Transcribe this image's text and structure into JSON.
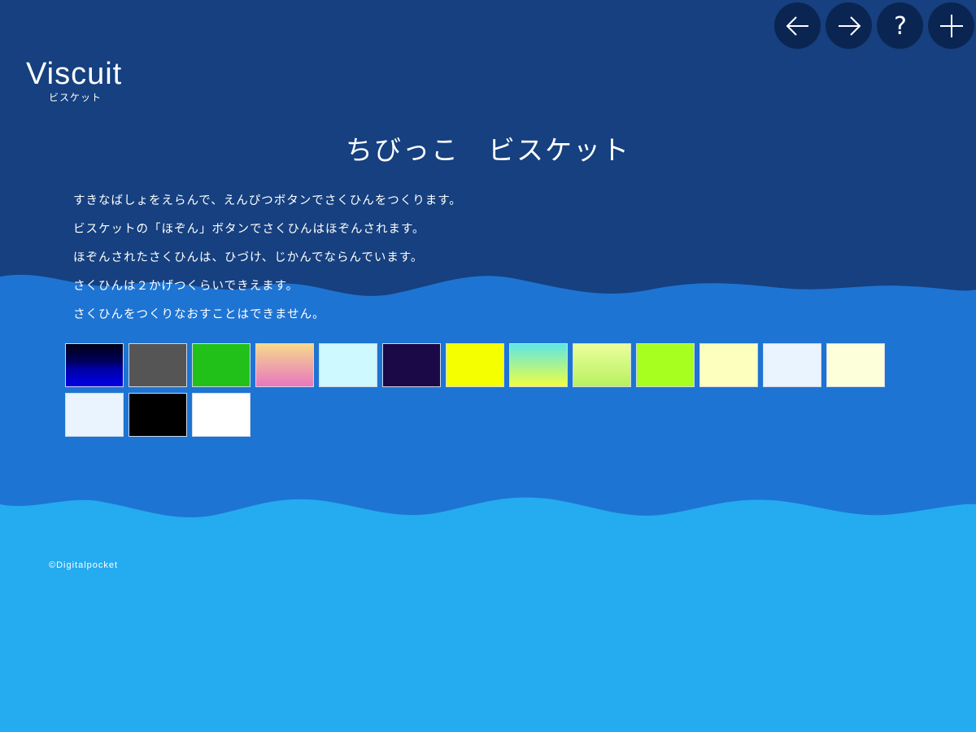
{
  "logo": {
    "main": "Viscuit",
    "sub": "ビスケット"
  },
  "nav": [
    {
      "name": "back-arrow-icon"
    },
    {
      "name": "forward-arrow-icon"
    },
    {
      "name": "help-icon",
      "glyph": "?"
    },
    {
      "name": "add-icon"
    }
  ],
  "title": "ちびっこ　ビスケット",
  "description": [
    "すきなばしょをえらんで、えんぴつボタンでさくひんをつくります。",
    "ビスケットの「ほぞん」ボタンでさくひんはほぞんされます。",
    "ほぞんされたさくひんは、ひづけ、じかんでならんでいます。",
    "さくひんは２かげつくらいできえます。",
    "さくひんをつくりなおすことはできません。"
  ],
  "swatches": [
    "linear-gradient(#000018 0%, #00005a 40%, #0000a8 60%, #0000e6 100%)",
    "#555555",
    "#22c11a",
    "linear-gradient(#f6d98b, #e877c0)",
    "#cdf9ff",
    "#1a0847",
    "#f5ff00",
    "linear-gradient(#5ee6e6, #f0ff40)",
    "linear-gradient(#eaff9c, #b8f060)",
    "#a6ff1e",
    "#fcffbe",
    "#eaf4ff",
    "#fdffdb",
    "#eaf4ff",
    "#000000",
    "#ffffff"
  ],
  "colors": {
    "top_band": "#16407f",
    "middle_band": "#1e74d3",
    "bottom_band": "#25abef",
    "button_bg": "#0b2552"
  },
  "copyright": "©Digitalpocket"
}
